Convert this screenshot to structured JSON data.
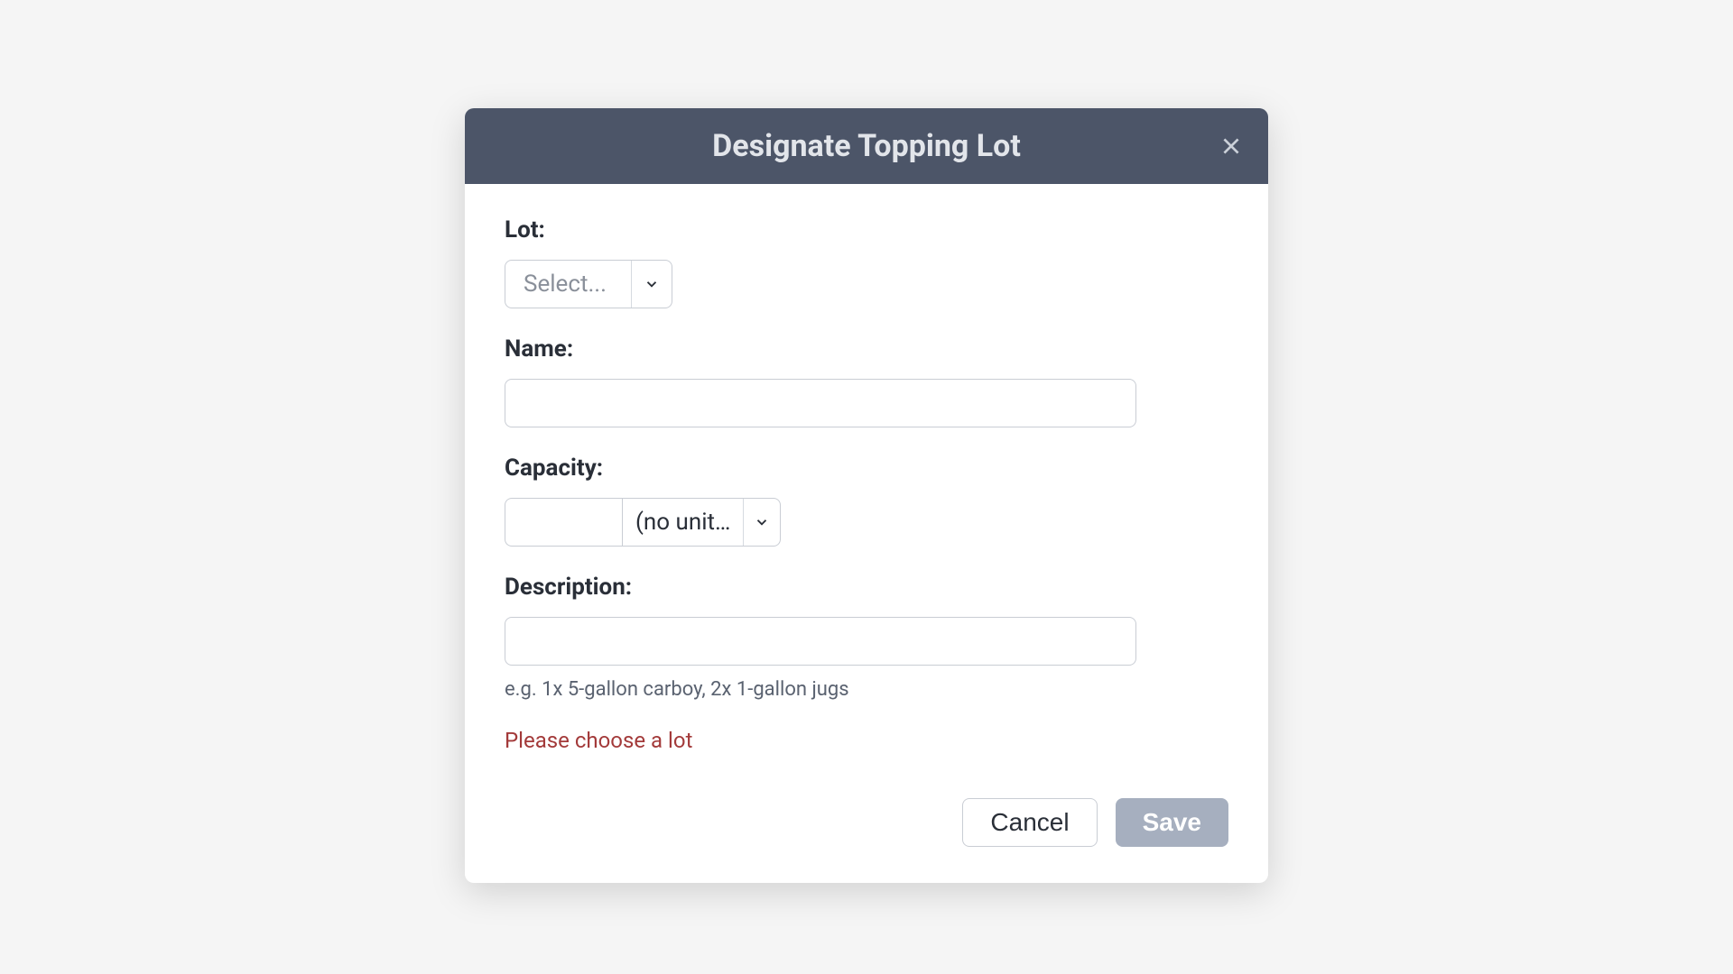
{
  "modal": {
    "title": "Designate Topping Lot",
    "fields": {
      "lot": {
        "label": "Lot:",
        "selected": "Select..."
      },
      "name": {
        "label": "Name:",
        "value": ""
      },
      "capacity": {
        "label": "Capacity:",
        "value": "",
        "unit_selected": "(no unit…"
      },
      "description": {
        "label": "Description:",
        "value": "",
        "help": "e.g. 1x 5-gallon carboy, 2x 1-gallon jugs"
      }
    },
    "error": "Please choose a lot",
    "buttons": {
      "cancel": "Cancel",
      "save": "Save"
    }
  }
}
